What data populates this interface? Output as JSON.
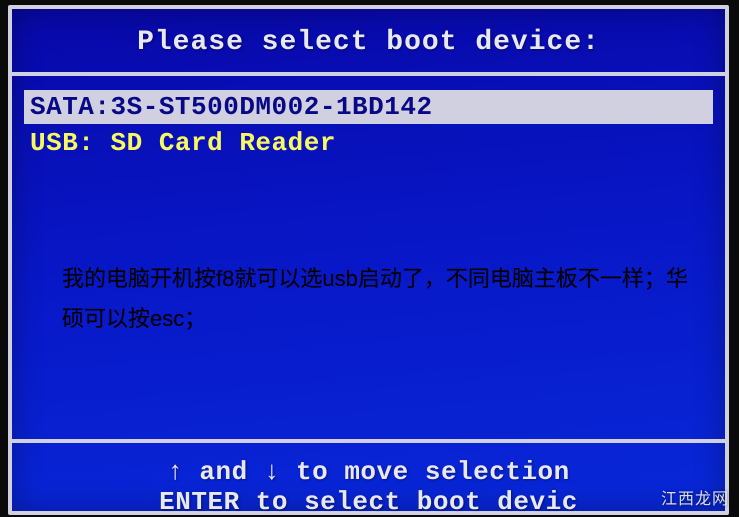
{
  "header": {
    "title": "Please select boot device:"
  },
  "devices": {
    "item_0": "SATA:3S-ST500DM002-1BD142",
    "item_1": "USB: SD Card Reader"
  },
  "annotation": {
    "text": "我的电脑开机按f8就可以选usb启动了，不同电脑主板不一样；华硕可以按esc；"
  },
  "footer": {
    "line_0": "↑ and ↓ to move selection",
    "line_1": "ENTER to select boot devic"
  },
  "watermark": {
    "text": "江西龙网"
  }
}
